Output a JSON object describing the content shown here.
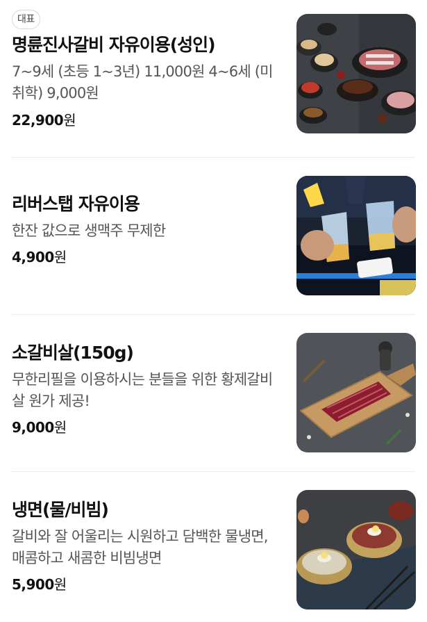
{
  "menu": {
    "items": [
      {
        "badge": "대표",
        "name": "명륜진사갈비 자유이용(성인)",
        "description": "7~9세 (초등 1~3년) 11,000원 4~6세 (미취학) 9,000원",
        "price": "22,900",
        "currency": "원",
        "image_icon": "bbq-set-photo"
      },
      {
        "name": "리버스탭 자유이용",
        "description": "한잔 값으로 생맥주 무제한",
        "price": "4,900",
        "currency": "원",
        "image_icon": "beer-tap-photo"
      },
      {
        "name": "소갈비살(150g)",
        "description": "무한리필을 이용하시는 분들을 위한 황제갈비살 원가 제공!",
        "price": "9,000",
        "currency": "원",
        "image_icon": "beef-rib-photo"
      },
      {
        "name": "냉면(물/비빔)",
        "description": "갈비와 잘 어울리는 시원하고 담백한 물냉면, 매콤하고 새콤한 비빔냉면",
        "price": "5,900",
        "currency": "원",
        "image_icon": "naengmyeon-photo"
      }
    ]
  }
}
